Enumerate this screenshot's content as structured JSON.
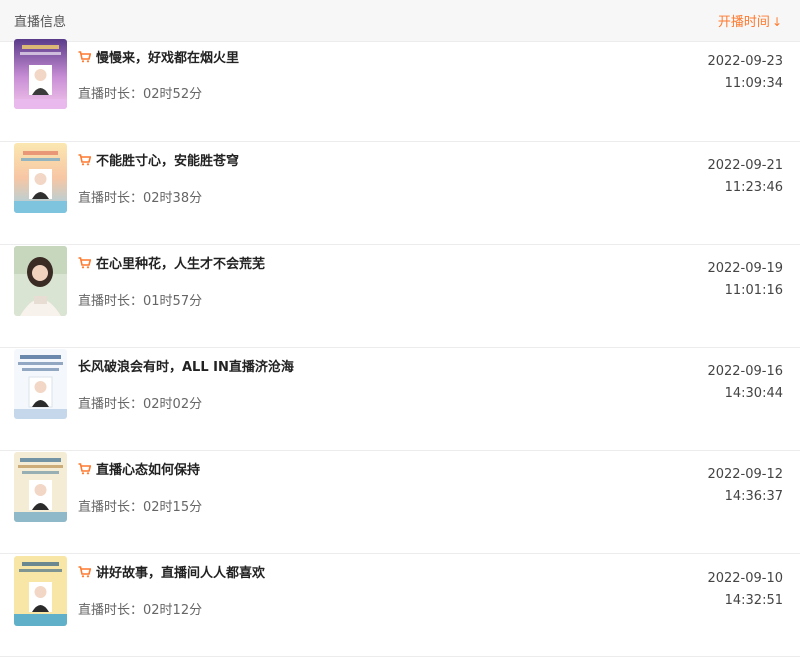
{
  "header": {
    "title": "直播信息",
    "sort_label": "开播时间",
    "sort_arrow": "↓"
  },
  "accent_color": "#ff7a2e",
  "rows": [
    {
      "title": "慢慢来，好戏都在烟火里",
      "has_cart": true,
      "duration": "直播时长：02时52分",
      "date": "2022-09-23",
      "time": "11:09:34",
      "thumb": "poster-pink"
    },
    {
      "title": "不能胜寸心，安能胜苍穹",
      "has_cart": true,
      "duration": "直播时长：02时38分",
      "date": "2022-09-21",
      "time": "11:23:46",
      "thumb": "poster-sunset"
    },
    {
      "title": "在心里种花，人生才不会荒芜",
      "has_cart": true,
      "duration": "直播时长：01时57分",
      "date": "2022-09-19",
      "time": "11:01:16",
      "thumb": "portrait-photo"
    },
    {
      "title": "长风破浪会有时，ALL IN直播济沧海",
      "has_cart": false,
      "duration": "直播时长：02时02分",
      "date": "2022-09-16",
      "time": "14:30:44",
      "thumb": "poster-white"
    },
    {
      "title": "直播心态如何保持",
      "has_cart": true,
      "duration": "直播时长：02时15分",
      "date": "2022-09-12",
      "time": "14:36:37",
      "thumb": "poster-beige"
    },
    {
      "title": "讲好故事，直播间人人都喜欢",
      "has_cart": true,
      "duration": "直播时长：02时12分",
      "date": "2022-09-10",
      "time": "14:32:51",
      "thumb": "poster-yellow"
    }
  ]
}
